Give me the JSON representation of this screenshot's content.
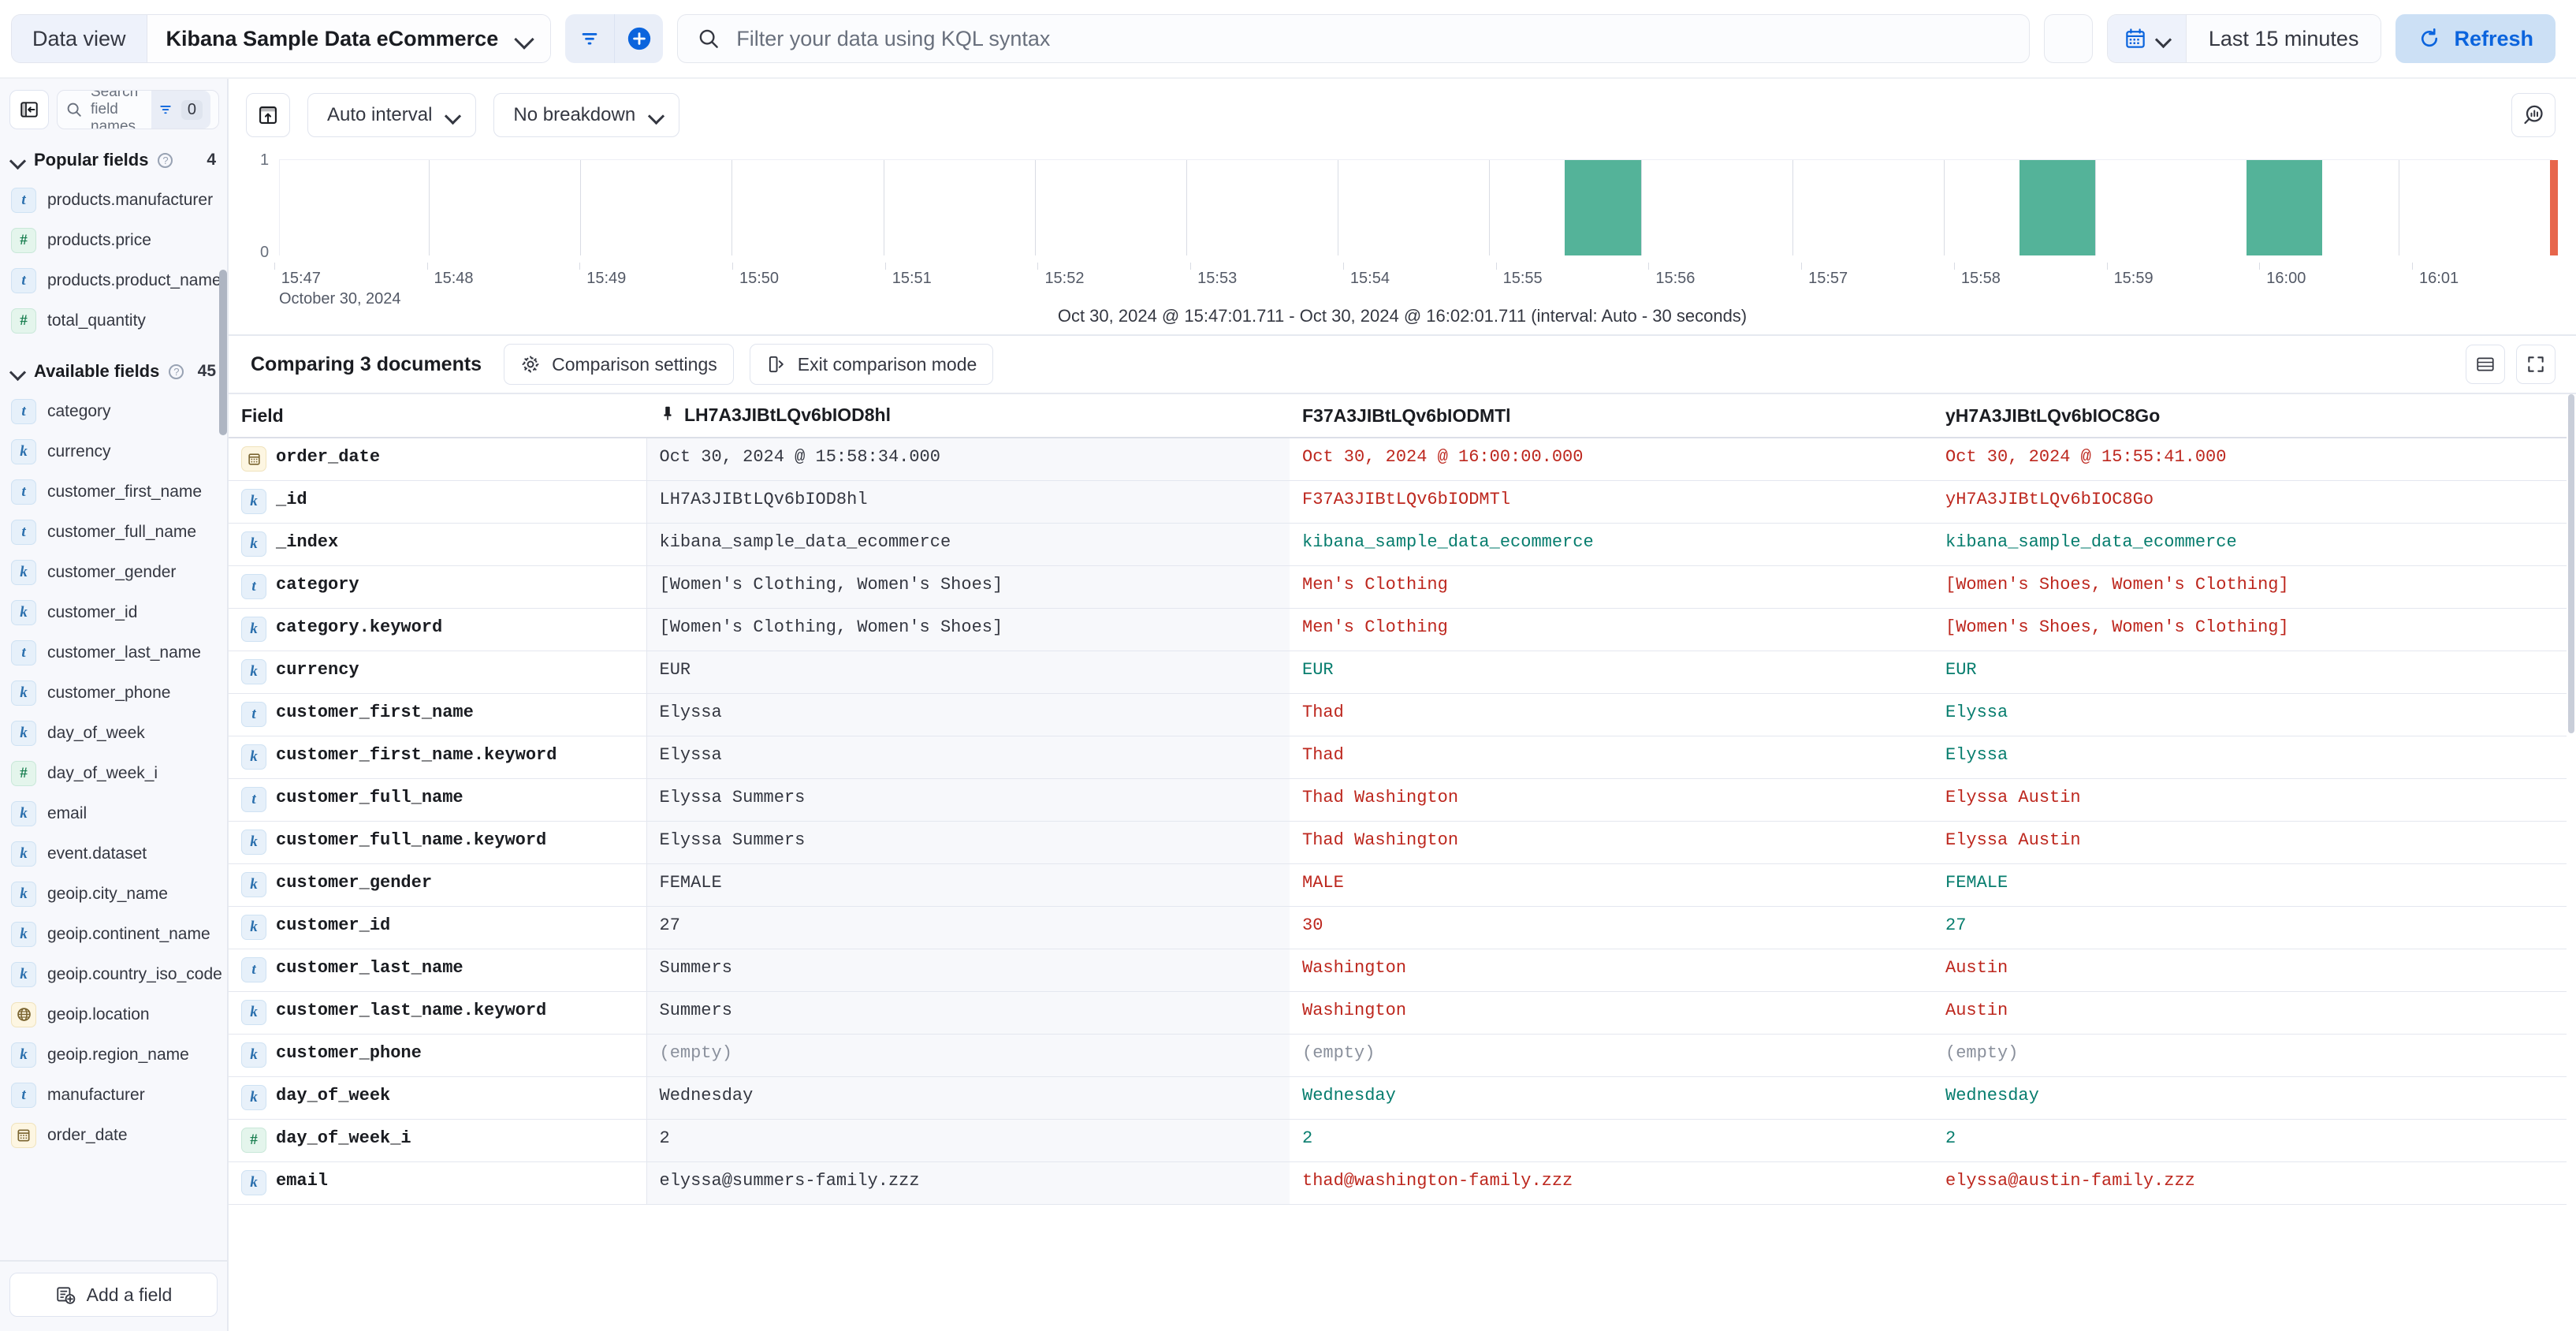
{
  "topbar": {
    "data_view_label": "Data view",
    "data_view_value": "Kibana Sample Data eCommerce",
    "search_placeholder": "Filter your data using KQL syntax",
    "time_range": "Last 15 minutes",
    "refresh_label": "Refresh"
  },
  "sidebar": {
    "search_placeholder": "Search field names",
    "filter_count": "0",
    "popular": {
      "title": "Popular fields",
      "count": "4"
    },
    "available": {
      "title": "Available fields",
      "count": "45"
    },
    "popular_fields": [
      {
        "name": "products.manufacturer",
        "type": "t"
      },
      {
        "name": "products.price",
        "type": "n"
      },
      {
        "name": "products.product_name",
        "type": "t"
      },
      {
        "name": "total_quantity",
        "type": "n"
      }
    ],
    "available_fields": [
      {
        "name": "category",
        "type": "t"
      },
      {
        "name": "currency",
        "type": "k"
      },
      {
        "name": "customer_first_name",
        "type": "t"
      },
      {
        "name": "customer_full_name",
        "type": "t"
      },
      {
        "name": "customer_gender",
        "type": "k"
      },
      {
        "name": "customer_id",
        "type": "k"
      },
      {
        "name": "customer_last_name",
        "type": "t"
      },
      {
        "name": "customer_phone",
        "type": "k"
      },
      {
        "name": "day_of_week",
        "type": "k"
      },
      {
        "name": "day_of_week_i",
        "type": "n"
      },
      {
        "name": "email",
        "type": "k"
      },
      {
        "name": "event.dataset",
        "type": "k"
      },
      {
        "name": "geoip.city_name",
        "type": "k"
      },
      {
        "name": "geoip.continent_name",
        "type": "k"
      },
      {
        "name": "geoip.country_iso_code",
        "type": "k"
      },
      {
        "name": "geoip.location",
        "type": "g"
      },
      {
        "name": "geoip.region_name",
        "type": "k"
      },
      {
        "name": "manufacturer",
        "type": "t"
      },
      {
        "name": "order_date",
        "type": "d"
      }
    ],
    "add_field_label": "Add a field"
  },
  "histogram_toolbar": {
    "interval_label": "Auto interval",
    "breakdown_label": "No breakdown"
  },
  "chart_data": {
    "type": "bar",
    "title": "",
    "xlabel": "October 30, 2024",
    "ylabel": "",
    "ylim": [
      0,
      1
    ],
    "y_ticks": [
      "0",
      "1"
    ],
    "x_ticks": [
      "15:47",
      "15:48",
      "15:49",
      "15:50",
      "15:51",
      "15:52",
      "15:53",
      "15:54",
      "15:55",
      "15:56",
      "15:57",
      "15:58",
      "15:59",
      "16:00",
      "16:01"
    ],
    "grid": true,
    "legend": "none",
    "categories": [
      "15:55:30",
      "15:58:30",
      "16:00:00",
      "16:02:00"
    ],
    "values": [
      1,
      1,
      1,
      1
    ],
    "bar_color": "#54b399",
    "partial_bar_color": "#e7664c",
    "interval_note": "Oct 30, 2024 @ 15:47:01.711 - Oct 30, 2024 @ 16:02:01.711 (interval: Auto - 30 seconds)"
  },
  "comparison": {
    "title": "Comparing 3 documents",
    "settings_label": "Comparison settings",
    "exit_label": "Exit comparison mode",
    "field_header": "Field",
    "doc_headers": [
      "LH7A3JIBtLQv6bIOD8hl",
      "F37A3JIBtLQv6bIODMTl",
      "yH7A3JIBtLQv6bIOC8Go"
    ],
    "rows": [
      {
        "field": "order_date",
        "type": "d",
        "values": [
          "Oct 30, 2024 @ 15:58:34.000",
          "Oct 30, 2024 @ 16:00:00.000",
          "Oct 30, 2024 @ 15:55:41.000"
        ],
        "states": [
          "base",
          "diff",
          "diff"
        ]
      },
      {
        "field": "_id",
        "type": "k",
        "values": [
          "LH7A3JIBtLQv6bIOD8hl",
          "F37A3JIBtLQv6bIODMTl",
          "yH7A3JIBtLQv6bIOC8Go"
        ],
        "states": [
          "base",
          "diff",
          "diff"
        ]
      },
      {
        "field": "_index",
        "type": "k",
        "values": [
          "kibana_sample_data_ecommerce",
          "kibana_sample_data_ecommerce",
          "kibana_sample_data_ecommerce"
        ],
        "states": [
          "base",
          "same",
          "same"
        ]
      },
      {
        "field": "category",
        "type": "t",
        "values": [
          "[Women's Clothing, Women's Shoes]",
          "Men's Clothing",
          "[Women's Shoes, Women's Clothing]"
        ],
        "states": [
          "base",
          "diff",
          "diff"
        ]
      },
      {
        "field": "category.keyword",
        "type": "k",
        "values": [
          "[Women's Clothing, Women's Shoes]",
          "Men's Clothing",
          "[Women's Shoes, Women's Clothing]"
        ],
        "states": [
          "base",
          "diff",
          "diff"
        ]
      },
      {
        "field": "currency",
        "type": "k",
        "values": [
          "EUR",
          "EUR",
          "EUR"
        ],
        "states": [
          "base",
          "same",
          "same"
        ]
      },
      {
        "field": "customer_first_name",
        "type": "t",
        "values": [
          "Elyssa",
          "Thad",
          "Elyssa"
        ],
        "states": [
          "base",
          "diff",
          "same"
        ]
      },
      {
        "field": "customer_first_name.keyword",
        "type": "k",
        "values": [
          "Elyssa",
          "Thad",
          "Elyssa"
        ],
        "states": [
          "base",
          "diff",
          "same"
        ]
      },
      {
        "field": "customer_full_name",
        "type": "t",
        "values": [
          "Elyssa Summers",
          "Thad Washington",
          "Elyssa Austin"
        ],
        "states": [
          "base",
          "diff",
          "diff"
        ]
      },
      {
        "field": "customer_full_name.keyword",
        "type": "k",
        "values": [
          "Elyssa Summers",
          "Thad Washington",
          "Elyssa Austin"
        ],
        "states": [
          "base",
          "diff",
          "diff"
        ]
      },
      {
        "field": "customer_gender",
        "type": "k",
        "values": [
          "FEMALE",
          "MALE",
          "FEMALE"
        ],
        "states": [
          "base",
          "diff",
          "same"
        ]
      },
      {
        "field": "customer_id",
        "type": "k",
        "values": [
          "27",
          "30",
          "27"
        ],
        "states": [
          "base",
          "diff",
          "same"
        ]
      },
      {
        "field": "customer_last_name",
        "type": "t",
        "values": [
          "Summers",
          "Washington",
          "Austin"
        ],
        "states": [
          "base",
          "diff",
          "diff"
        ]
      },
      {
        "field": "customer_last_name.keyword",
        "type": "k",
        "values": [
          "Summers",
          "Washington",
          "Austin"
        ],
        "states": [
          "base",
          "diff",
          "diff"
        ]
      },
      {
        "field": "customer_phone",
        "type": "k",
        "values": [
          "(empty)",
          "(empty)",
          "(empty)"
        ],
        "states": [
          "base-empty",
          "same",
          "same"
        ]
      },
      {
        "field": "day_of_week",
        "type": "k",
        "values": [
          "Wednesday",
          "Wednesday",
          "Wednesday"
        ],
        "states": [
          "base",
          "same",
          "same"
        ]
      },
      {
        "field": "day_of_week_i",
        "type": "n",
        "values": [
          "2",
          "2",
          "2"
        ],
        "states": [
          "base",
          "same",
          "same"
        ]
      },
      {
        "field": "email",
        "type": "k",
        "values": [
          "elyssa@summers-family.zzz",
          "thad@washington-family.zzz",
          "elyssa@austin-family.zzz"
        ],
        "states": [
          "base",
          "diff",
          "diff"
        ]
      }
    ]
  },
  "icons": {
    "filter": "filter-icon",
    "add": "add-filter-icon",
    "search": "search-icon",
    "calendar": "calendar-icon",
    "refresh": "refresh-icon",
    "collapse": "collapse-sidebar-icon",
    "chart_toggle": "chart-toggle-icon",
    "lens": "lens-icon",
    "gear": "gear-icon",
    "exit": "exit-icon",
    "pin": "pin-icon",
    "add_field": "add-field-icon"
  }
}
